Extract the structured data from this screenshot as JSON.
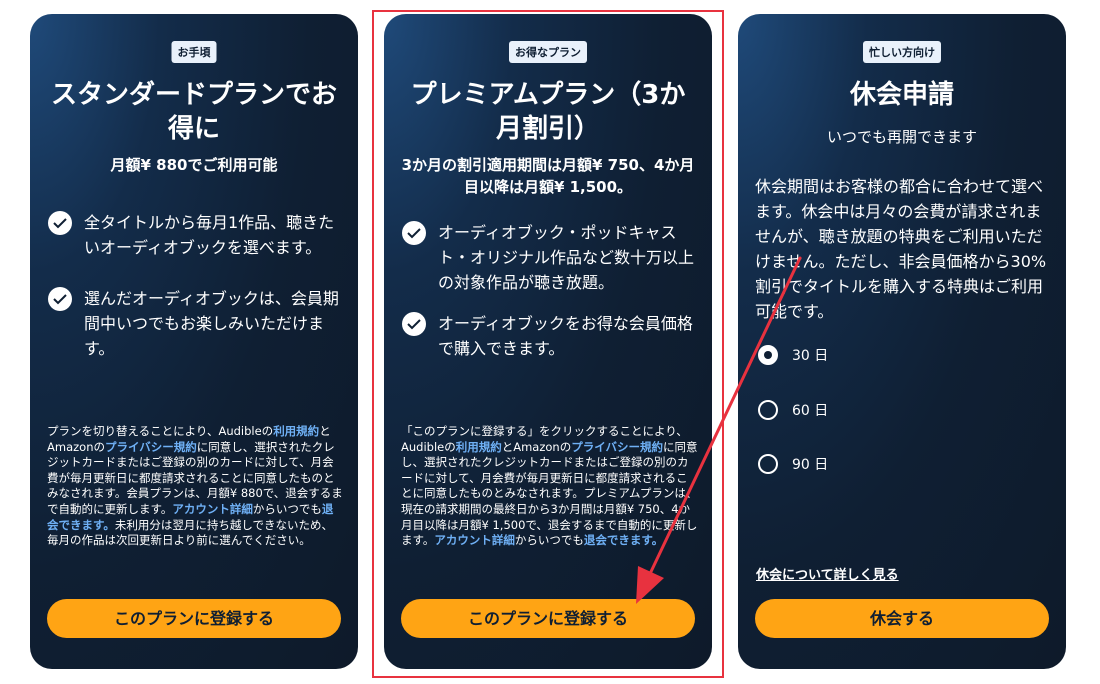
{
  "colors": {
    "accent": "#ffa414",
    "link": "#6fb0f5",
    "card_bg": "#0f1f33",
    "highlight": "#e8323f"
  },
  "standard": {
    "badge": "お手頃",
    "title": "スタンダードプランでお得に",
    "price": "月額¥ 880でご利用可能",
    "features": [
      "全タイトルから毎月1作品、聴きたいオーディオブックを選べます。",
      "選んだオーディオブックは、会員期間中いつでもお楽しみいただけます。"
    ],
    "fine_a": "プランを切り替えることにより、Audibleの",
    "terms_link": "利用規約",
    "fine_b": "とAmazonの",
    "privacy_link": "プライバシー規約",
    "fine_c": "に同意し、選択されたクレジットカードまたはご登録の別のカードに対して、月会費が毎月更新日に都度請求されることに同意したものとみなされます。会員プランは、月額¥ 880で、退会するまで自動的に更新します。",
    "account_link": "アカウント詳細",
    "fine_d": "からいつでも",
    "cancel_link": "退会できます。",
    "fine_e": "未利用分は翌月に持ち越しできないため、毎月の作品は次回更新日より前に選んでください。",
    "cta": "このプランに登録する"
  },
  "premium": {
    "badge": "お得なプラン",
    "title": "プレミアムプラン（3か月割引）",
    "price": "3か月の割引適用期間は月額¥ 750、4か月目以降は月額¥ 1,500。",
    "features": [
      "オーディオブック・ポッドキャスト・オリジナル作品など数十万以上の対象作品が聴き放題。",
      "オーディオブックをお得な会員価格で購入できます。"
    ],
    "fine_a": "「このプランに登録する」をクリックすることにより、Audibleの",
    "terms_link": "利用規約",
    "fine_b": "とAmazonの",
    "privacy_link": "プライバシー規約",
    "fine_c": "に同意し、選択されたクレジットカードまたはご登録の別のカードに対して、月会費が毎月更新日に都度請求されることに同意したものとみなされます。プレミアムプランは、現在の請求期間の最終日から3か月間は月額¥ 750、4か月目以降は月額¥ 1,500で、退会するまで自動的に更新します。",
    "account_link": "アカウント詳細",
    "fine_d": "からいつでも",
    "cancel_link": "退会できます。",
    "cta": "このプランに登録する"
  },
  "pause": {
    "badge": "忙しい方向け",
    "title": "休会申請",
    "subtitle": "いつでも再開できます",
    "description": "休会期間はお客様の都合に合わせて選べます。休会中は月々の会費が請求されませんが、聴き放題の特典をご利用いただけません。ただし、非会員価格から30%割引でタイトルを購入する特典はご利用可能です。",
    "options": [
      {
        "label": "30 日",
        "selected": true
      },
      {
        "label": "60 日",
        "selected": false
      },
      {
        "label": "90 日",
        "selected": false
      }
    ],
    "more_link": "休会について詳しく見る",
    "cta": "休会する"
  }
}
